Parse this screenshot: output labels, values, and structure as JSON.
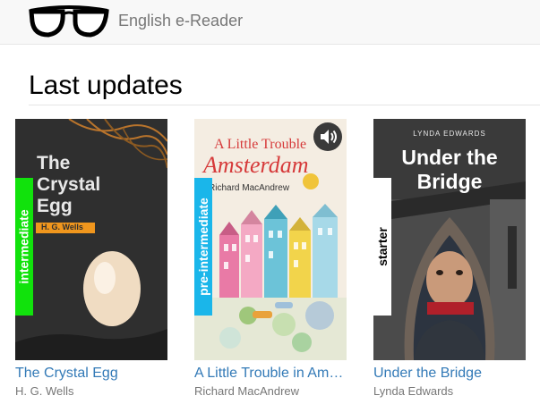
{
  "header": {
    "brand": "English e-Reader",
    "logo_icon": "glasses-icon"
  },
  "section": {
    "title": "Last updates"
  },
  "books": [
    {
      "title": "The Crystal Egg",
      "author": "H. G. Wells",
      "level": "intermediate",
      "level_color": "#11e20c",
      "level_text_color": "#ffffff",
      "cover_title": "The Crystal Egg",
      "cover_author": "H. G. Wells"
    },
    {
      "title": "A Little Trouble in Amsterdam",
      "author": "Richard MacAndrew",
      "level": "pre-intermediate",
      "level_color": "#1ab6ea",
      "level_text_color": "#ffffff",
      "cover_title_line1": "A Little Trouble",
      "cover_title_line2": "Amsterdam",
      "cover_author": "Richard MacAndrew",
      "audio_icon": "speaker-icon"
    },
    {
      "title": "Under the Bridge",
      "author": "Lynda Edwards",
      "level": "starter",
      "level_color": "#ffffff",
      "level_text_color": "#000000",
      "cover_title": "Under the Bridge",
      "cover_author": "LYNDA EDWARDS"
    }
  ]
}
